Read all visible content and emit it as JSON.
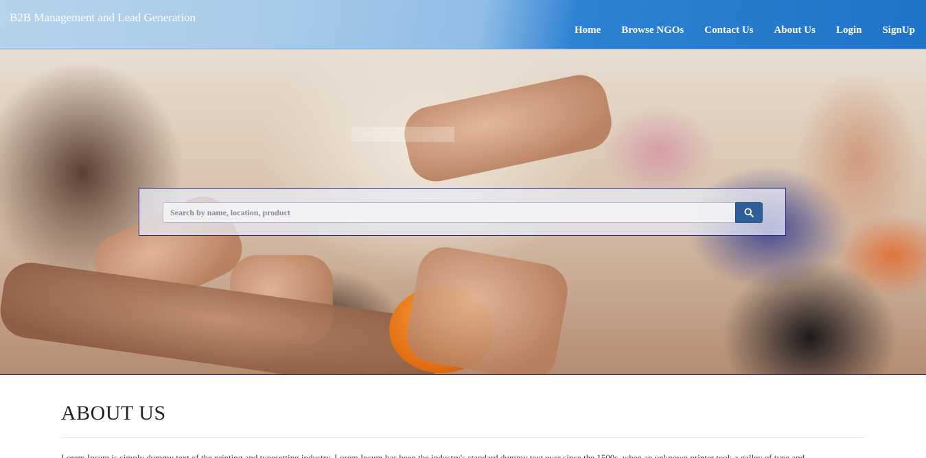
{
  "header": {
    "brand": "B2B Management and Lead Generation",
    "nav": [
      {
        "label": "Home"
      },
      {
        "label": "Browse NGOs"
      },
      {
        "label": "Contact Us"
      },
      {
        "label": "About Us"
      },
      {
        "label": "Login"
      },
      {
        "label": "SignUp"
      }
    ]
  },
  "hero": {
    "search": {
      "placeholder": "Search by name, location, product",
      "value": "",
      "button_icon": "search-icon"
    }
  },
  "about": {
    "title": "ABOUT US",
    "text": "Lorem Ipsum is simply dummy text of the printing and typesetting industry. Lorem Ipsum has been the industry's standard dummy text ever since the 1500s, when an unknown printer took a galley of type and"
  },
  "colors": {
    "header_start": "#b6d3ec",
    "header_end": "#1f73c9",
    "search_button": "#2f5f9a",
    "panel_border": "#2b2b8f"
  }
}
